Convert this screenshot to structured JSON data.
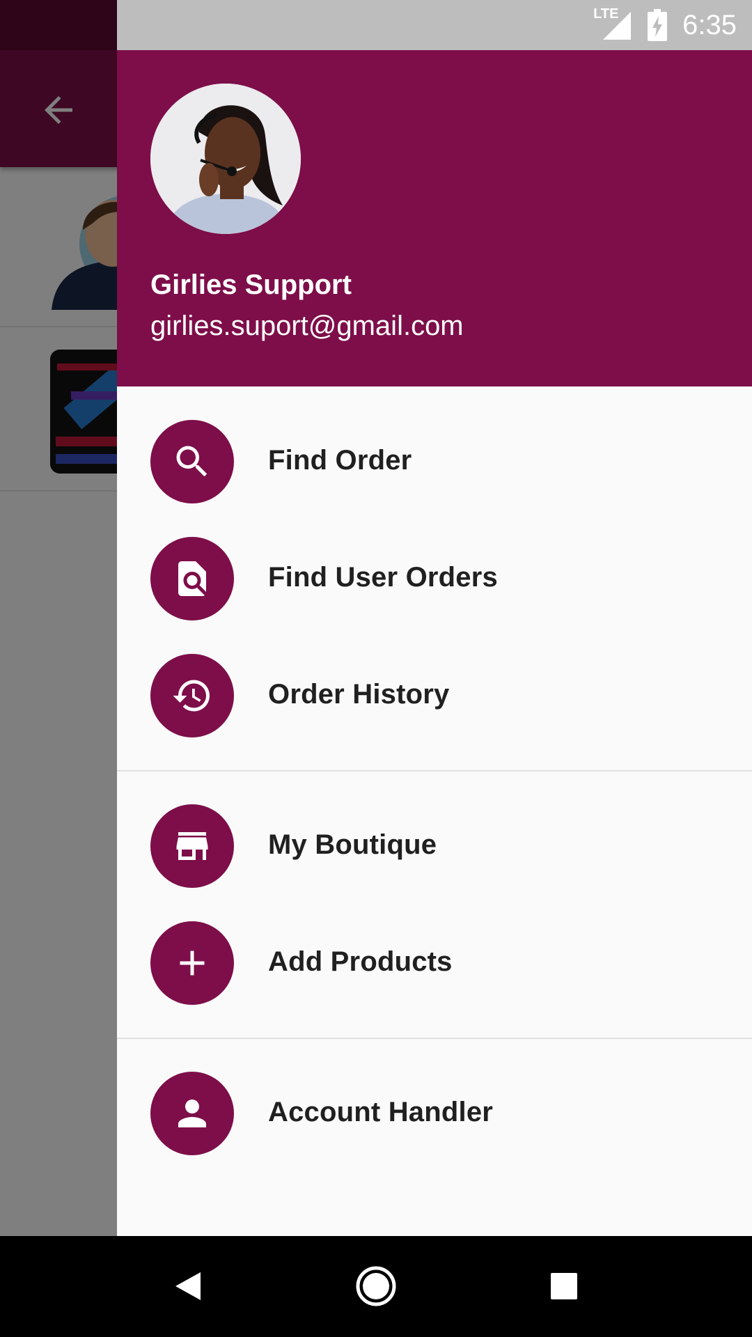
{
  "status_bar": {
    "network": "LTE",
    "time": "6:35"
  },
  "drawer": {
    "profile": {
      "name": "Girlies Support",
      "email": "girlies.suport@gmail.com"
    },
    "items": [
      {
        "label": "Find Order",
        "icon": "search-icon"
      },
      {
        "label": "Find User Orders",
        "icon": "find-in-page-icon"
      },
      {
        "label": "Order History",
        "icon": "history-icon"
      },
      {
        "label": "My Boutique",
        "icon": "store-icon"
      },
      {
        "label": "Add Products",
        "icon": "add-icon"
      },
      {
        "label": "Account Handler",
        "icon": "person-icon"
      }
    ]
  },
  "colors": {
    "primary": "#7d0e49",
    "drawer_bg": "#fafafa",
    "statusbar": "#bdbdbd"
  }
}
